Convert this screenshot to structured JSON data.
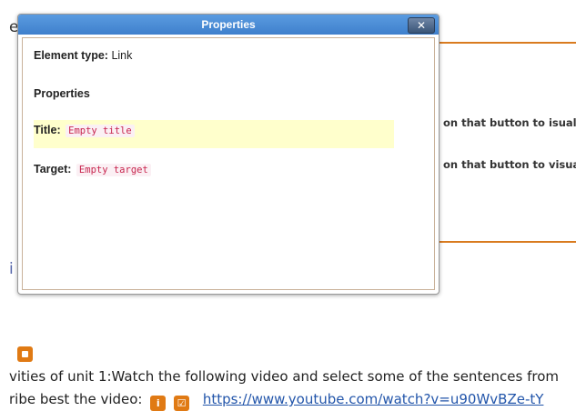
{
  "dialog": {
    "title": "Properties",
    "close_label": "✕",
    "element_type_label": "Element type:",
    "element_type_value": "Link",
    "section_heading": "Properties",
    "title_field": {
      "label": "Title:",
      "value": "Empty title"
    },
    "target_field": {
      "label": "Target:",
      "value": "Empty target"
    }
  },
  "background": {
    "top_letter": "e",
    "line_a": "on that button to isual",
    "line_b": "on that button to visua",
    "blue_letter": "i",
    "activity_line": "vities of unit 1:Watch the following video and select some of the sentences from",
    "describe_line": "ribe best the video:",
    "info_icon_glyph": "i",
    "check_icon_glyph": "☑",
    "link_text": "https://www.youtube.com/watch?v=u90WvBZe-tY"
  }
}
